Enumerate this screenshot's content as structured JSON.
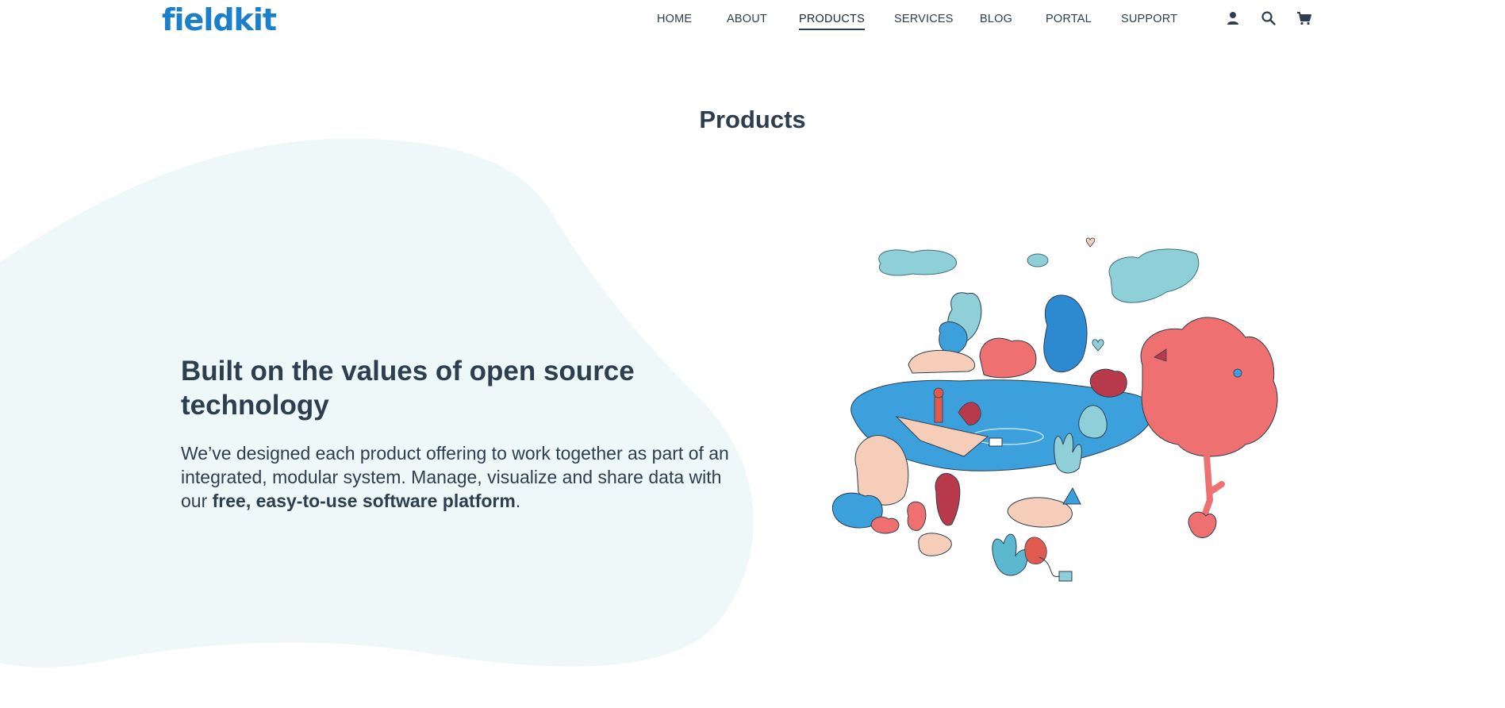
{
  "brand": {
    "logo_text": "fieldkit",
    "accent": "#1b80c9",
    "text_color": "#2c3e50",
    "blob_color": "#eef8f8"
  },
  "nav": {
    "items": [
      {
        "label": "HOME",
        "active": false
      },
      {
        "label": "ABOUT",
        "active": false
      },
      {
        "label": "PRODUCTS",
        "active": true
      },
      {
        "label": "SERVICES",
        "active": false
      },
      {
        "label": "BLOG",
        "active": false
      },
      {
        "label": "PORTAL",
        "active": false
      },
      {
        "label": "SUPPORT",
        "active": false
      }
    ],
    "icons": [
      "account-icon",
      "search-icon",
      "cart-icon"
    ]
  },
  "page": {
    "title": "Products"
  },
  "hero": {
    "heading": "Built on the values of open source technology",
    "body_prefix": "We’ve designed each product offering to work together as part of an integrated, modular system. Manage, visualize and share data with our ",
    "body_bold": "free, easy-to-use software platform",
    "body_suffix": "."
  }
}
